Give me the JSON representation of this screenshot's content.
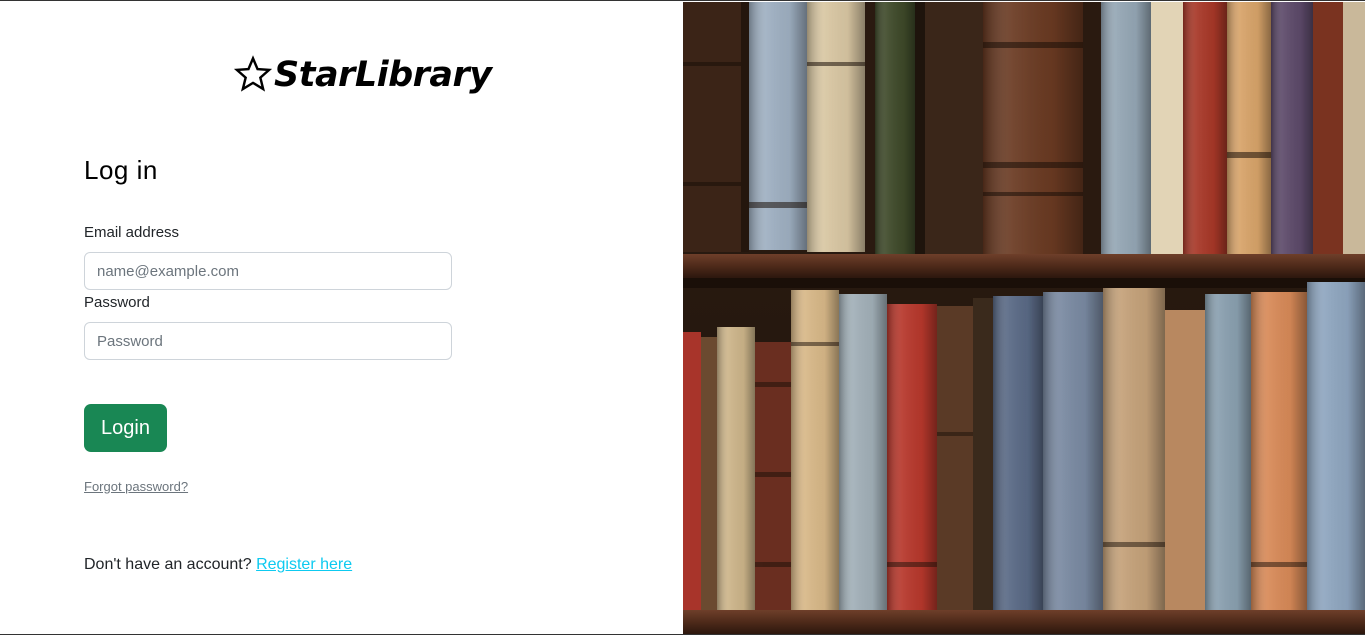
{
  "brand": {
    "name": "StarLibrary",
    "icon": "star-outline-icon"
  },
  "login_form": {
    "title": "Log in",
    "email_label": "Email address",
    "email_placeholder": "name@example.com",
    "email_value": "",
    "password_label": "Password",
    "password_placeholder": "Password",
    "password_value": "",
    "submit_label": "Login",
    "forgot_password_label": "Forgot password?"
  },
  "register": {
    "prompt": "Don't have an account?",
    "link_label": "Register here"
  },
  "colors": {
    "primary_button": "#198754",
    "link": "#0dcaf0",
    "muted_link": "#6c757d"
  },
  "hero_image": {
    "icon": "bookshelf-illustration"
  }
}
